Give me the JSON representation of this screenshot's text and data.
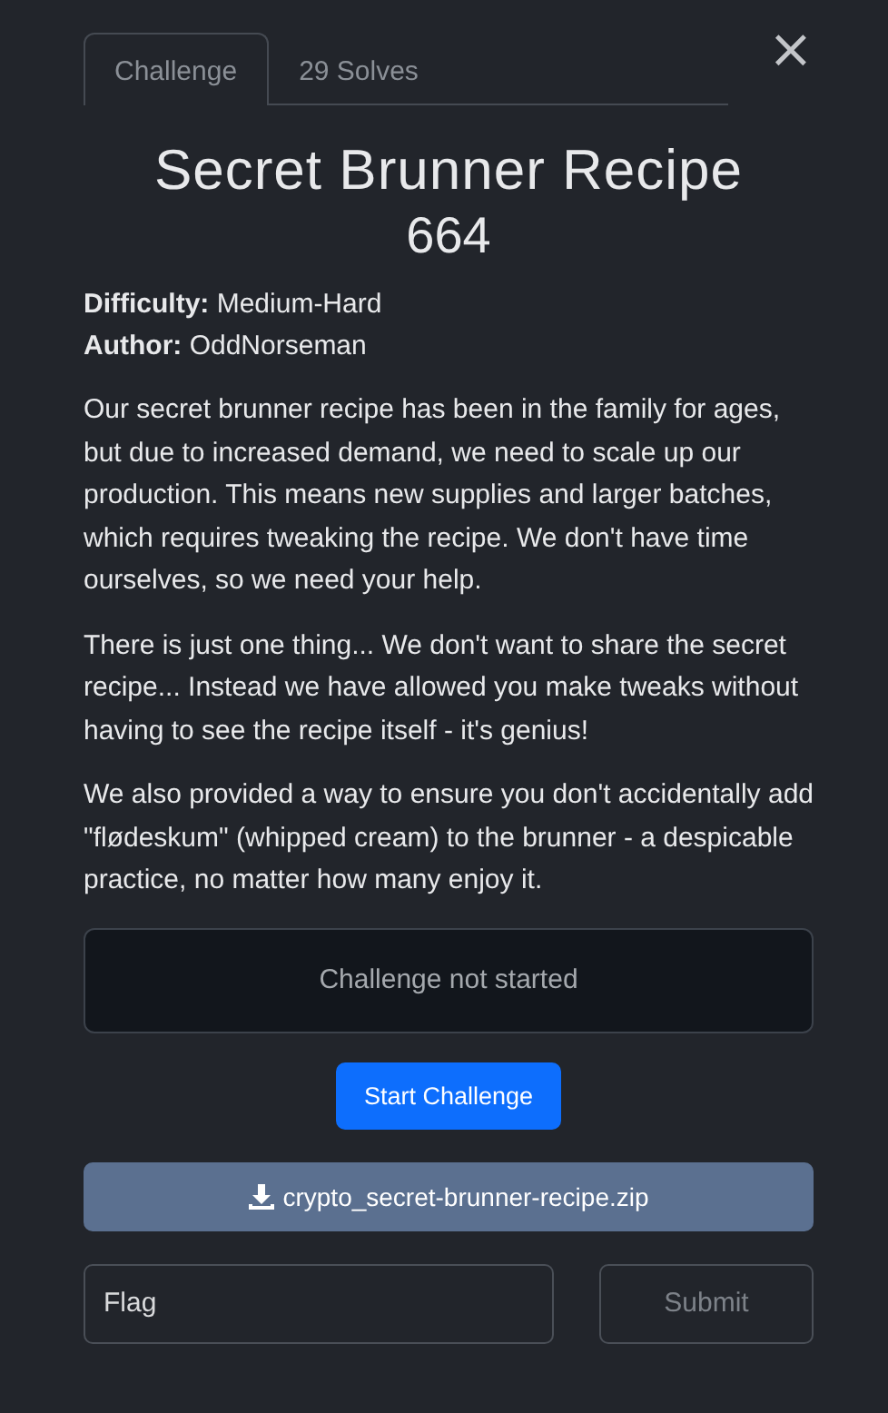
{
  "tabs": [
    {
      "label": "Challenge",
      "selected": true
    },
    {
      "label": "29 Solves",
      "selected": false
    }
  ],
  "close": "×",
  "title": "Secret Brunner Recipe",
  "points": "664",
  "meta": [
    {
      "label": "Difficulty:",
      "value": "Medium-Hard"
    },
    {
      "label": "Author:",
      "value": "OddNorseman"
    }
  ],
  "paragraphs": [
    "Our secret brunner recipe has been in the family for ages, but due to increased demand, we need to scale up our production. This means new supplies and larger batches, which requires tweaking the recipe. We don't have time ourselves, so we need your help.",
    "There is just one thing... We don't want to share the secret recipe... Instead we have allowed you make tweaks without having to see the recipe itself - it's genius!",
    "We also provided a way to ensure you don't accidentally add \"flødeskum\" (whipped cream) to the brunner - a despicable practice, no matter how many enjoy it."
  ],
  "status": "Challenge not started",
  "start_button": "Start Challenge",
  "file": "crypto_secret-brunner-recipe.zip",
  "flag": {
    "placeholder": "Flag"
  },
  "submit": {
    "label": "Submit",
    "disabled": true
  }
}
